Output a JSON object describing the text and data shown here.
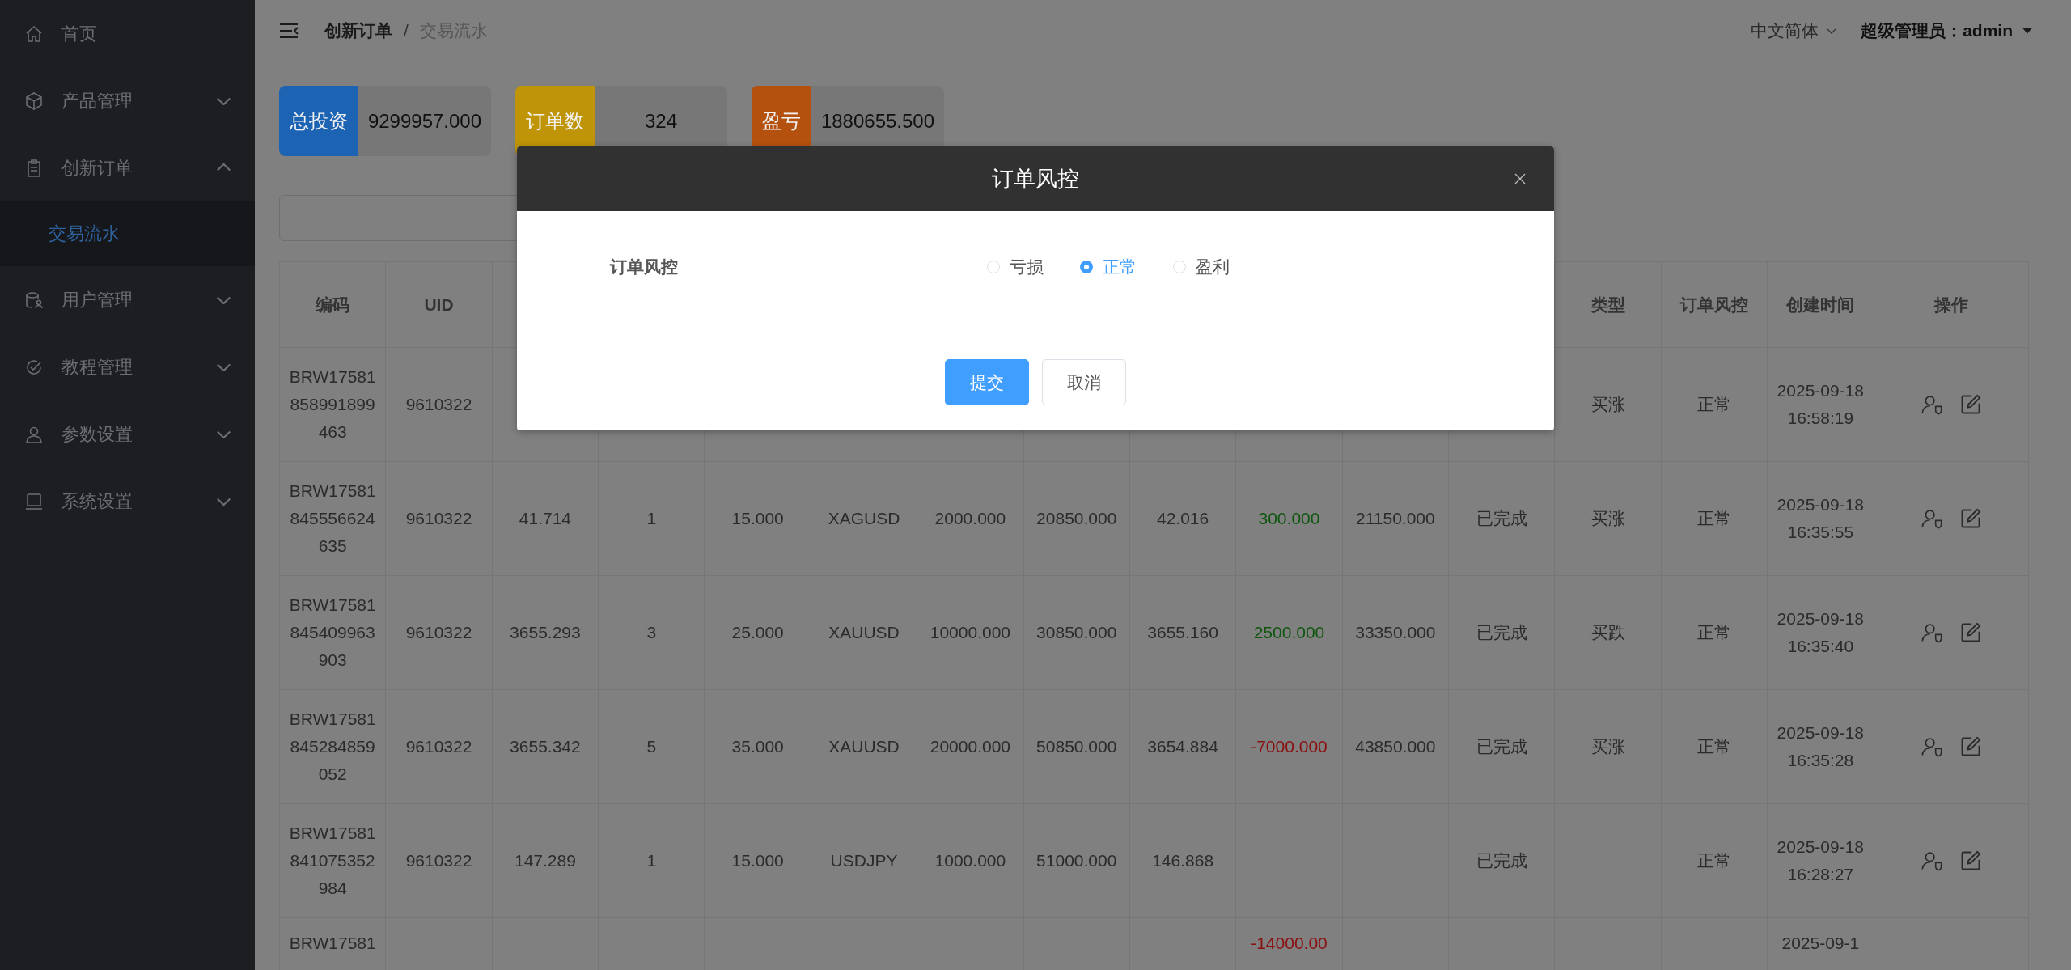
{
  "sidebar": {
    "items": [
      {
        "label": "首页",
        "kind": "link"
      },
      {
        "label": "产品管理",
        "kind": "menu",
        "expanded": false
      },
      {
        "label": "创新订单",
        "kind": "menu",
        "expanded": true,
        "children": [
          {
            "label": "交易流水",
            "selected": true
          }
        ]
      },
      {
        "label": "用户管理",
        "kind": "menu",
        "expanded": false
      },
      {
        "label": "教程管理",
        "kind": "menu",
        "expanded": false
      },
      {
        "label": "参数设置",
        "kind": "menu",
        "expanded": false
      },
      {
        "label": "系统设置",
        "kind": "menu",
        "expanded": false
      }
    ]
  },
  "header": {
    "breadcrumb": [
      "创新订单",
      "交易流水"
    ],
    "separator": "/",
    "language": "中文简体",
    "user": "超级管理员：admin"
  },
  "stats": [
    {
      "label": "总投资",
      "value": "9299957.000",
      "color": "#1c63b4"
    },
    {
      "label": "订单数",
      "value": "324",
      "color": "#bf9407"
    },
    {
      "label": "盈亏",
      "value": "1880655.500",
      "color": "#b5510f"
    }
  ],
  "table": {
    "columns": [
      {
        "label": "编码"
      },
      {
        "label": "UID"
      },
      {},
      {},
      {},
      {},
      {},
      {},
      {},
      {},
      {},
      {},
      {
        "label": "类型"
      },
      {
        "label": "订单风控"
      },
      {
        "label": "创建时间"
      },
      {
        "label": "操作"
      }
    ],
    "rows": [
      {
        "code": "BRW17581858991899463",
        "uid": "9610322",
        "type": "买涨",
        "risk_control": "正常",
        "created_at": "2025-09-18 16:58:19"
      },
      {
        "code": "BRW17581845556624635",
        "uid": "9610322",
        "column_3": "41.714",
        "column_4": "1",
        "column_5": "15.000",
        "column_6": "XAGUSD",
        "column_7": "2000.000",
        "column_8": "20850.000",
        "column_9": "42.016",
        "column_10": "300.000",
        "color": "#0e560e",
        "column_11": "21150.000",
        "column_12": "已完成",
        "type": "买涨",
        "risk_control": "正常",
        "created_at": "2025-09-18 16:35:55"
      },
      {
        "code": "BRW17581845409963903",
        "uid": "9610322",
        "column_3": "3655.293",
        "column_4": "3",
        "column_5": "25.000",
        "column_6": "XAUUSD",
        "column_7": "10000.000",
        "column_8": "30850.000",
        "column_9": "3655.160",
        "column_10": "2500.000",
        "color": "#0e560e",
        "column_11": "33350.000",
        "column_12": "已完成",
        "type": "买跌",
        "risk_control": "正常",
        "created_at": "2025-09-18 16:35:40"
      },
      {
        "code": "BRW17581845284859052",
        "uid": "9610322",
        "column_3": "3655.342",
        "column_4": "5",
        "column_5": "35.000",
        "column_6": "XAUUSD",
        "column_7": "20000.000",
        "column_8": "50850.000",
        "column_9": "3654.884",
        "column_10": "-7000.000",
        "color": "#8a1010",
        "column_11": "43850.000",
        "column_12": "已完成",
        "type": "买涨",
        "risk_control": "正常",
        "created_at": "2025-09-18 16:35:28"
      },
      {
        "code": "BRW17581841075352984",
        "uid": "9610322",
        "column_3": "147.289",
        "column_4": "1",
        "column_5": "15.000",
        "column_6": "USDJPY",
        "column_7": "1000.000",
        "column_8": "51000.000",
        "column_9": "146.868",
        "column_12": "已完成",
        "risk_control": "正常",
        "created_at": "2025-09-18 16:28:27"
      },
      {
        "code": "BRW17581",
        "column_10": "-14000.00",
        "color": "#8a1010",
        "created_at": "2025-09-1"
      }
    ]
  },
  "dialog": {
    "title": "订单风控",
    "field_label": "订单风控",
    "options": [
      {
        "label": "亏损",
        "selected": false
      },
      {
        "label": "正常",
        "selected": true
      },
      {
        "label": "盈利",
        "selected": false
      }
    ],
    "submit": "提交",
    "cancel": "取消"
  }
}
